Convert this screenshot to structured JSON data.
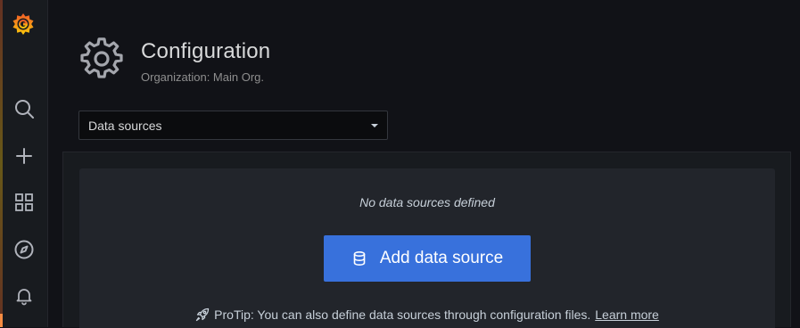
{
  "app": {
    "brand_color": "#f05a28",
    "accent_color": "#3871dc"
  },
  "sidebar": {
    "items": [
      {
        "name": "search",
        "icon": "search-icon"
      },
      {
        "name": "create",
        "icon": "plus-icon"
      },
      {
        "name": "dashboards",
        "icon": "apps-icon"
      },
      {
        "name": "explore",
        "icon": "compass-icon"
      },
      {
        "name": "alerting",
        "icon": "bell-icon"
      }
    ]
  },
  "header": {
    "title": "Configuration",
    "subtitle": "Organization: Main Org.",
    "icon": "gear-icon"
  },
  "section_select": {
    "value": "Data sources"
  },
  "empty_state": {
    "title": "No data sources defined",
    "button_label": "Add data source",
    "button_icon": "database-icon",
    "protip_icon": "rocket-icon",
    "protip_text": "ProTip: You can also define data sources through configuration files.",
    "learn_more_label": "Learn more"
  }
}
